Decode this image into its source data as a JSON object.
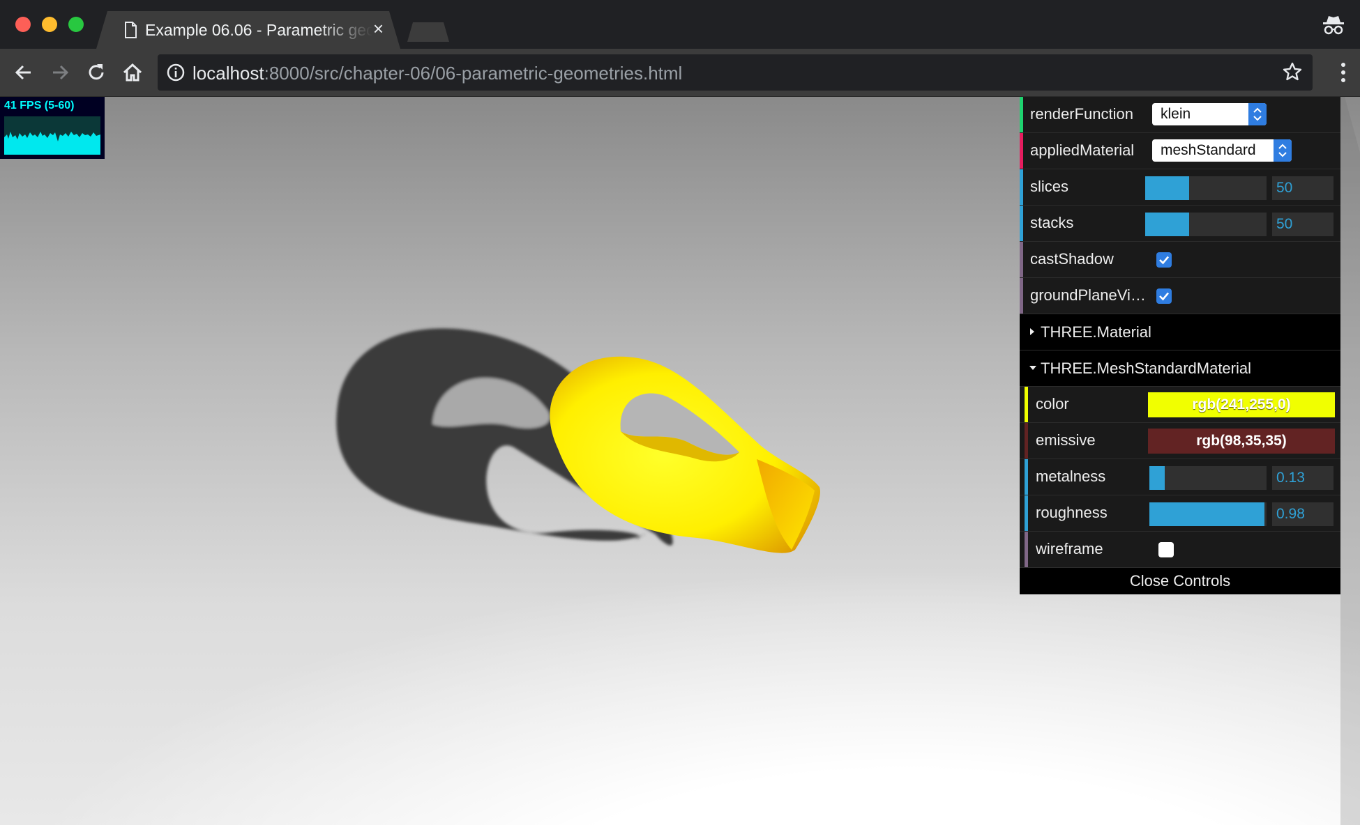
{
  "browser": {
    "tab_title": "Example 06.06 - Parametric geometries",
    "tab_close": "×",
    "url_host": "localhost",
    "url_path": ":8000/src/chapter-06/06-parametric-geometries.html"
  },
  "stats": {
    "fps_text": "41 FPS (5-60)",
    "color": "#00ffff"
  },
  "gui": {
    "controllers": {
      "render_function": {
        "label": "renderFunction",
        "value": "klein",
        "stripe": "#1ed36f"
      },
      "applied_material": {
        "label": "appliedMaterial",
        "value": "meshStandard",
        "stripe": "#e61d5f"
      },
      "slices": {
        "label": "slices",
        "value": "50",
        "fraction": 0.36,
        "stripe": "#2fa1d6"
      },
      "stacks": {
        "label": "stacks",
        "value": "50",
        "fraction": 0.36,
        "stripe": "#2fa1d6"
      },
      "cast_shadow": {
        "label": "castShadow",
        "checked": true,
        "stripe": "#806787"
      },
      "ground_plane_visible": {
        "label": "groundPlaneVi…",
        "checked": true,
        "stripe": "#806787"
      }
    },
    "folders": {
      "three_material": {
        "title": "THREE.Material",
        "open": false
      },
      "mesh_standard_material": {
        "title": "THREE.MeshStandardMaterial",
        "open": true,
        "color": {
          "label": "color",
          "value": "rgb(241,255,0)",
          "hex": "#f1ff00"
        },
        "emissive": {
          "label": "emissive",
          "value": "rgb(98,35,35)",
          "hex": "#622323"
        },
        "metalness": {
          "label": "metalness",
          "value": "0.13",
          "fraction": 0.13
        },
        "roughness": {
          "label": "roughness",
          "value": "0.98",
          "fraction": 0.98
        },
        "wireframe": {
          "label": "wireframe",
          "checked": false
        }
      }
    },
    "close_label": "Close Controls"
  }
}
